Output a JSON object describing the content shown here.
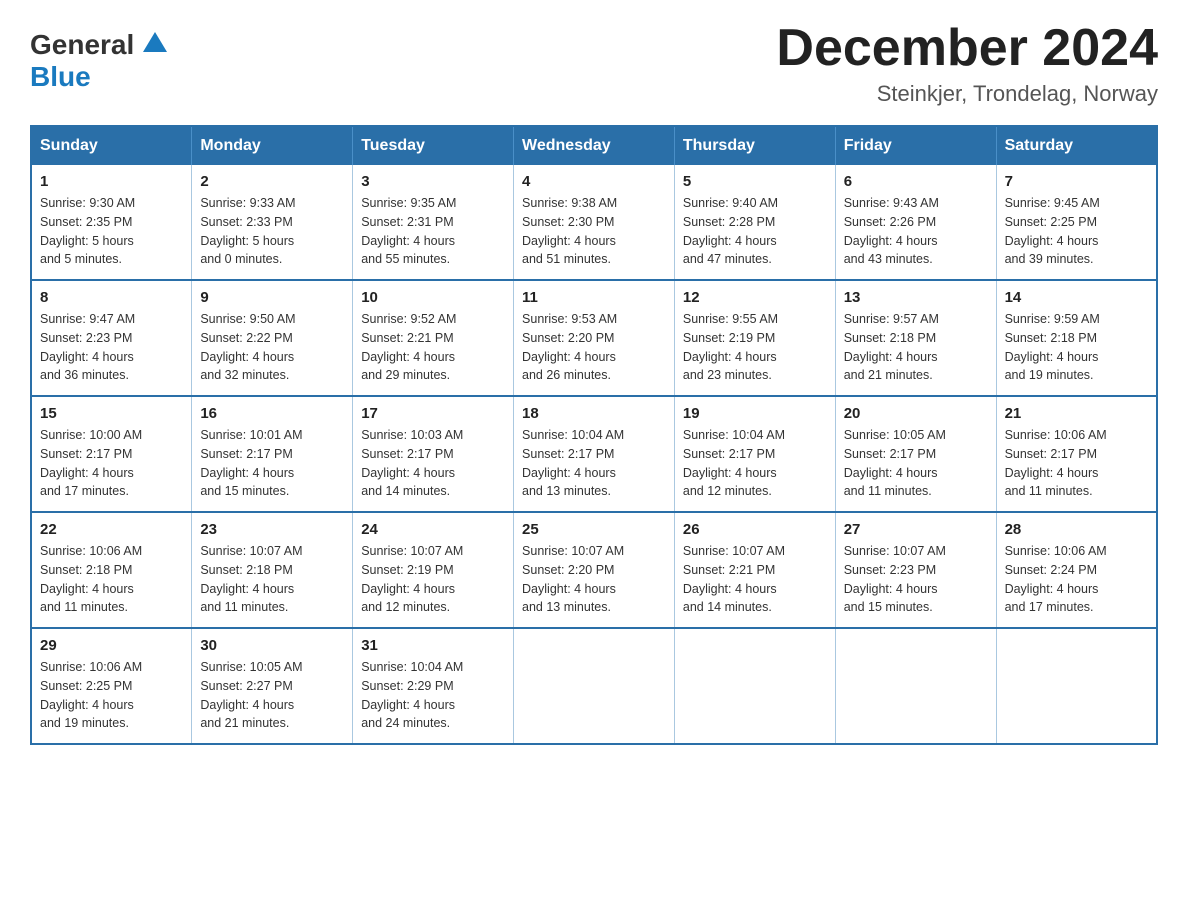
{
  "logo": {
    "general": "General",
    "blue": "Blue"
  },
  "title": "December 2024",
  "subtitle": "Steinkjer, Trondelag, Norway",
  "days_of_week": [
    "Sunday",
    "Monday",
    "Tuesday",
    "Wednesday",
    "Thursday",
    "Friday",
    "Saturday"
  ],
  "weeks": [
    [
      {
        "day": "1",
        "sunrise": "Sunrise: 9:30 AM",
        "sunset": "Sunset: 2:35 PM",
        "daylight": "Daylight: 5 hours",
        "daylight2": "and 5 minutes."
      },
      {
        "day": "2",
        "sunrise": "Sunrise: 9:33 AM",
        "sunset": "Sunset: 2:33 PM",
        "daylight": "Daylight: 5 hours",
        "daylight2": "and 0 minutes."
      },
      {
        "day": "3",
        "sunrise": "Sunrise: 9:35 AM",
        "sunset": "Sunset: 2:31 PM",
        "daylight": "Daylight: 4 hours",
        "daylight2": "and 55 minutes."
      },
      {
        "day": "4",
        "sunrise": "Sunrise: 9:38 AM",
        "sunset": "Sunset: 2:30 PM",
        "daylight": "Daylight: 4 hours",
        "daylight2": "and 51 minutes."
      },
      {
        "day": "5",
        "sunrise": "Sunrise: 9:40 AM",
        "sunset": "Sunset: 2:28 PM",
        "daylight": "Daylight: 4 hours",
        "daylight2": "and 47 minutes."
      },
      {
        "day": "6",
        "sunrise": "Sunrise: 9:43 AM",
        "sunset": "Sunset: 2:26 PM",
        "daylight": "Daylight: 4 hours",
        "daylight2": "and 43 minutes."
      },
      {
        "day": "7",
        "sunrise": "Sunrise: 9:45 AM",
        "sunset": "Sunset: 2:25 PM",
        "daylight": "Daylight: 4 hours",
        "daylight2": "and 39 minutes."
      }
    ],
    [
      {
        "day": "8",
        "sunrise": "Sunrise: 9:47 AM",
        "sunset": "Sunset: 2:23 PM",
        "daylight": "Daylight: 4 hours",
        "daylight2": "and 36 minutes."
      },
      {
        "day": "9",
        "sunrise": "Sunrise: 9:50 AM",
        "sunset": "Sunset: 2:22 PM",
        "daylight": "Daylight: 4 hours",
        "daylight2": "and 32 minutes."
      },
      {
        "day": "10",
        "sunrise": "Sunrise: 9:52 AM",
        "sunset": "Sunset: 2:21 PM",
        "daylight": "Daylight: 4 hours",
        "daylight2": "and 29 minutes."
      },
      {
        "day": "11",
        "sunrise": "Sunrise: 9:53 AM",
        "sunset": "Sunset: 2:20 PM",
        "daylight": "Daylight: 4 hours",
        "daylight2": "and 26 minutes."
      },
      {
        "day": "12",
        "sunrise": "Sunrise: 9:55 AM",
        "sunset": "Sunset: 2:19 PM",
        "daylight": "Daylight: 4 hours",
        "daylight2": "and 23 minutes."
      },
      {
        "day": "13",
        "sunrise": "Sunrise: 9:57 AM",
        "sunset": "Sunset: 2:18 PM",
        "daylight": "Daylight: 4 hours",
        "daylight2": "and 21 minutes."
      },
      {
        "day": "14",
        "sunrise": "Sunrise: 9:59 AM",
        "sunset": "Sunset: 2:18 PM",
        "daylight": "Daylight: 4 hours",
        "daylight2": "and 19 minutes."
      }
    ],
    [
      {
        "day": "15",
        "sunrise": "Sunrise: 10:00 AM",
        "sunset": "Sunset: 2:17 PM",
        "daylight": "Daylight: 4 hours",
        "daylight2": "and 17 minutes."
      },
      {
        "day": "16",
        "sunrise": "Sunrise: 10:01 AM",
        "sunset": "Sunset: 2:17 PM",
        "daylight": "Daylight: 4 hours",
        "daylight2": "and 15 minutes."
      },
      {
        "day": "17",
        "sunrise": "Sunrise: 10:03 AM",
        "sunset": "Sunset: 2:17 PM",
        "daylight": "Daylight: 4 hours",
        "daylight2": "and 14 minutes."
      },
      {
        "day": "18",
        "sunrise": "Sunrise: 10:04 AM",
        "sunset": "Sunset: 2:17 PM",
        "daylight": "Daylight: 4 hours",
        "daylight2": "and 13 minutes."
      },
      {
        "day": "19",
        "sunrise": "Sunrise: 10:04 AM",
        "sunset": "Sunset: 2:17 PM",
        "daylight": "Daylight: 4 hours",
        "daylight2": "and 12 minutes."
      },
      {
        "day": "20",
        "sunrise": "Sunrise: 10:05 AM",
        "sunset": "Sunset: 2:17 PM",
        "daylight": "Daylight: 4 hours",
        "daylight2": "and 11 minutes."
      },
      {
        "day": "21",
        "sunrise": "Sunrise: 10:06 AM",
        "sunset": "Sunset: 2:17 PM",
        "daylight": "Daylight: 4 hours",
        "daylight2": "and 11 minutes."
      }
    ],
    [
      {
        "day": "22",
        "sunrise": "Sunrise: 10:06 AM",
        "sunset": "Sunset: 2:18 PM",
        "daylight": "Daylight: 4 hours",
        "daylight2": "and 11 minutes."
      },
      {
        "day": "23",
        "sunrise": "Sunrise: 10:07 AM",
        "sunset": "Sunset: 2:18 PM",
        "daylight": "Daylight: 4 hours",
        "daylight2": "and 11 minutes."
      },
      {
        "day": "24",
        "sunrise": "Sunrise: 10:07 AM",
        "sunset": "Sunset: 2:19 PM",
        "daylight": "Daylight: 4 hours",
        "daylight2": "and 12 minutes."
      },
      {
        "day": "25",
        "sunrise": "Sunrise: 10:07 AM",
        "sunset": "Sunset: 2:20 PM",
        "daylight": "Daylight: 4 hours",
        "daylight2": "and 13 minutes."
      },
      {
        "day": "26",
        "sunrise": "Sunrise: 10:07 AM",
        "sunset": "Sunset: 2:21 PM",
        "daylight": "Daylight: 4 hours",
        "daylight2": "and 14 minutes."
      },
      {
        "day": "27",
        "sunrise": "Sunrise: 10:07 AM",
        "sunset": "Sunset: 2:23 PM",
        "daylight": "Daylight: 4 hours",
        "daylight2": "and 15 minutes."
      },
      {
        "day": "28",
        "sunrise": "Sunrise: 10:06 AM",
        "sunset": "Sunset: 2:24 PM",
        "daylight": "Daylight: 4 hours",
        "daylight2": "and 17 minutes."
      }
    ],
    [
      {
        "day": "29",
        "sunrise": "Sunrise: 10:06 AM",
        "sunset": "Sunset: 2:25 PM",
        "daylight": "Daylight: 4 hours",
        "daylight2": "and 19 minutes."
      },
      {
        "day": "30",
        "sunrise": "Sunrise: 10:05 AM",
        "sunset": "Sunset: 2:27 PM",
        "daylight": "Daylight: 4 hours",
        "daylight2": "and 21 minutes."
      },
      {
        "day": "31",
        "sunrise": "Sunrise: 10:04 AM",
        "sunset": "Sunset: 2:29 PM",
        "daylight": "Daylight: 4 hours",
        "daylight2": "and 24 minutes."
      },
      null,
      null,
      null,
      null
    ]
  ]
}
